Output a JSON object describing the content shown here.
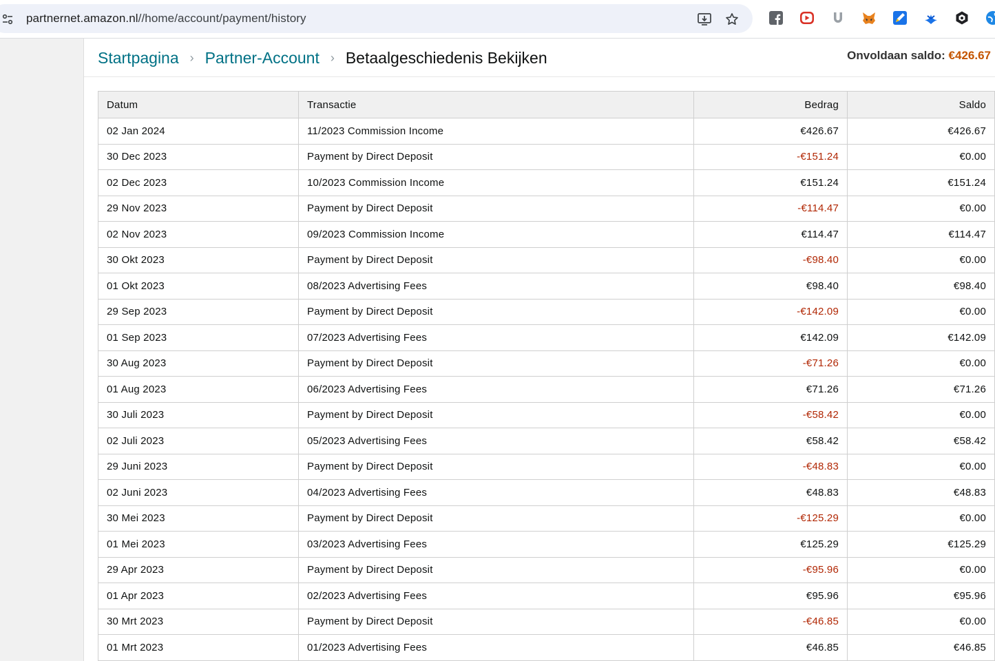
{
  "browser": {
    "url_host": "partnernet.amazon.nl",
    "url_path": "//home/account/payment/history"
  },
  "breadcrumb": {
    "items": [
      "Startpagina",
      "Partner-Account"
    ],
    "current": "Betaalgeschiedenis Bekijken"
  },
  "balance": {
    "label": "Onvoldaan saldo:",
    "amount": "€426.67"
  },
  "table": {
    "headers": [
      "Datum",
      "Transactie",
      "Bedrag",
      "Saldo"
    ],
    "rows": [
      {
        "date": "02 Jan 2024",
        "tx": "11/2023 Commission Income",
        "amount": "€426.67",
        "balance": "€426.67",
        "neg": false
      },
      {
        "date": "30 Dec 2023",
        "tx": "Payment by Direct Deposit",
        "amount": "-€151.24",
        "balance": "€0.00",
        "neg": true
      },
      {
        "date": "02 Dec 2023",
        "tx": "10/2023 Commission Income",
        "amount": "€151.24",
        "balance": "€151.24",
        "neg": false
      },
      {
        "date": "29 Nov 2023",
        "tx": "Payment by Direct Deposit",
        "amount": "-€114.47",
        "balance": "€0.00",
        "neg": true
      },
      {
        "date": "02 Nov 2023",
        "tx": "09/2023 Commission Income",
        "amount": "€114.47",
        "balance": "€114.47",
        "neg": false
      },
      {
        "date": "30 Okt 2023",
        "tx": "Payment by Direct Deposit",
        "amount": "-€98.40",
        "balance": "€0.00",
        "neg": true
      },
      {
        "date": "01 Okt 2023",
        "tx": "08/2023 Advertising Fees",
        "amount": "€98.40",
        "balance": "€98.40",
        "neg": false
      },
      {
        "date": "29 Sep 2023",
        "tx": "Payment by Direct Deposit",
        "amount": "-€142.09",
        "balance": "€0.00",
        "neg": true
      },
      {
        "date": "01 Sep 2023",
        "tx": "07/2023 Advertising Fees",
        "amount": "€142.09",
        "balance": "€142.09",
        "neg": false
      },
      {
        "date": "30 Aug 2023",
        "tx": "Payment by Direct Deposit",
        "amount": "-€71.26",
        "balance": "€0.00",
        "neg": true
      },
      {
        "date": "01 Aug 2023",
        "tx": "06/2023 Advertising Fees",
        "amount": "€71.26",
        "balance": "€71.26",
        "neg": false
      },
      {
        "date": "30 Juli 2023",
        "tx": "Payment by Direct Deposit",
        "amount": "-€58.42",
        "balance": "€0.00",
        "neg": true
      },
      {
        "date": "02 Juli 2023",
        "tx": "05/2023 Advertising Fees",
        "amount": "€58.42",
        "balance": "€58.42",
        "neg": false
      },
      {
        "date": "29 Juni 2023",
        "tx": "Payment by Direct Deposit",
        "amount": "-€48.83",
        "balance": "€0.00",
        "neg": true
      },
      {
        "date": "02 Juni 2023",
        "tx": "04/2023 Advertising Fees",
        "amount": "€48.83",
        "balance": "€48.83",
        "neg": false
      },
      {
        "date": "30 Mei 2023",
        "tx": "Payment by Direct Deposit",
        "amount": "-€125.29",
        "balance": "€0.00",
        "neg": true
      },
      {
        "date": "01 Mei 2023",
        "tx": "03/2023 Advertising Fees",
        "amount": "€125.29",
        "balance": "€125.29",
        "neg": false
      },
      {
        "date": "29 Apr 2023",
        "tx": "Payment by Direct Deposit",
        "amount": "-€95.96",
        "balance": "€0.00",
        "neg": true
      },
      {
        "date": "01 Apr 2023",
        "tx": "02/2023 Advertising Fees",
        "amount": "€95.96",
        "balance": "€95.96",
        "neg": false
      },
      {
        "date": "30 Mrt 2023",
        "tx": "Payment by Direct Deposit",
        "amount": "-€46.85",
        "balance": "€0.00",
        "neg": true
      },
      {
        "date": "01 Mrt 2023",
        "tx": "01/2023 Advertising Fees",
        "amount": "€46.85",
        "balance": "€46.85",
        "neg": false
      }
    ]
  },
  "icons": {
    "site_info": "tune-icon",
    "install": "install-app-icon",
    "bookmark": "star-icon",
    "extensions": [
      "facebook-extension-icon",
      "video-extension-icon",
      "u-extension-icon",
      "fox-extension-icon",
      "pen-extension-icon",
      "bird-extension-icon",
      "hexagon-extension-icon",
      "globe-extension-icon"
    ]
  },
  "colors": {
    "link": "#007185",
    "negative": "#b12704",
    "balance_amount": "#c45500"
  }
}
